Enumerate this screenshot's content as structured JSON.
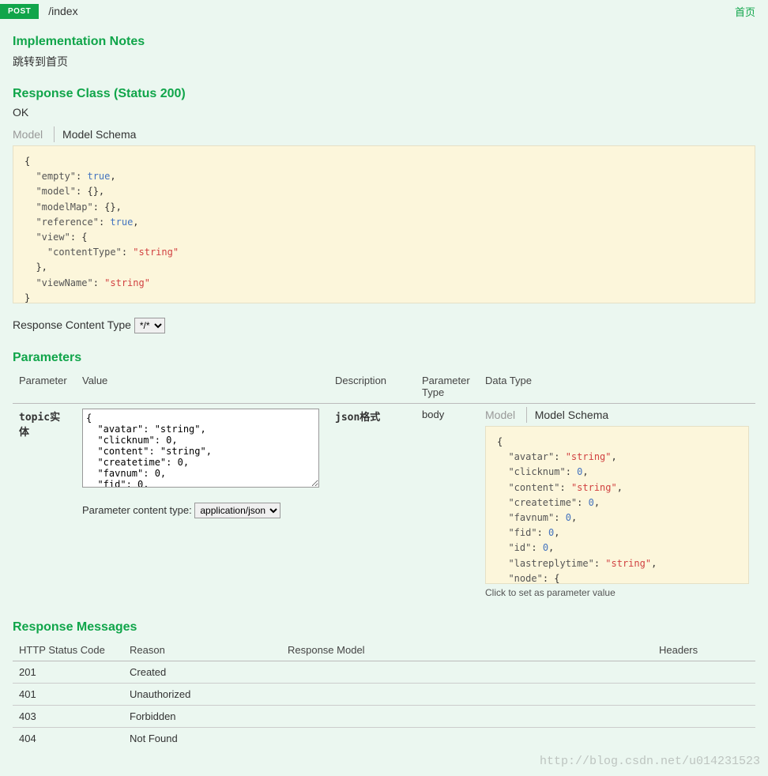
{
  "header": {
    "method": "POST",
    "path": "/index",
    "summary": "首页"
  },
  "impl": {
    "title": "Implementation Notes",
    "text": "跳转到首页"
  },
  "respclass": {
    "title": "Response Class (Status 200)",
    "ok": "OK",
    "tab_model": "Model",
    "tab_schema": "Model Schema"
  },
  "respContentType": {
    "label": "Response Content Type",
    "value": "*/*"
  },
  "parameters": {
    "title": "Parameters",
    "cols": {
      "c1": "Parameter",
      "c2": "Value",
      "c3": "Description",
      "c4": "Parameter Type",
      "c5": "Data Type"
    },
    "row": {
      "name": "topic实体",
      "desc": "json格式",
      "ptype": "body",
      "pct_label": "Parameter content type:",
      "pct_value": "application/json",
      "tab_model": "Model",
      "tab_schema": "Model Schema",
      "hint": "Click to set as parameter value"
    }
  },
  "respmsg": {
    "title": "Response Messages",
    "cols": {
      "c1": "HTTP Status Code",
      "c2": "Reason",
      "c3": "Response Model",
      "c4": "Headers"
    },
    "rows": [
      {
        "code": "201",
        "reason": "Created"
      },
      {
        "code": "401",
        "reason": "Unauthorized"
      },
      {
        "code": "403",
        "reason": "Forbidden"
      },
      {
        "code": "404",
        "reason": "Not Found"
      }
    ]
  },
  "json": {
    "response_schema": "{\n  \"empty\": true,\n  \"model\": {},\n  \"modelMap\": {},\n  \"reference\": true,\n  \"view\": {\n    \"contentType\": \"string\"\n  },\n  \"viewName\": \"string\"\n}",
    "textarea_value": "{\n  \"avatar\": \"string\",\n  \"clicknum\": 0,\n  \"content\": \"string\",\n  \"createtime\": 0,\n  \"favnum\": 0,\n  \"fid\": 0,",
    "param_schema": "{\n  \"avatar\": \"string\",\n  \"clicknum\": 0,\n  \"content\": \"string\",\n  \"createtime\": 0,\n  \"favnum\": 0,\n  \"fid\": 0,\n  \"id\": 0,\n  \"lastreplytime\": \"string\",\n  \"node\": {\n    \"id\": 0"
  },
  "watermark": "http://blog.csdn.net/u014231523"
}
